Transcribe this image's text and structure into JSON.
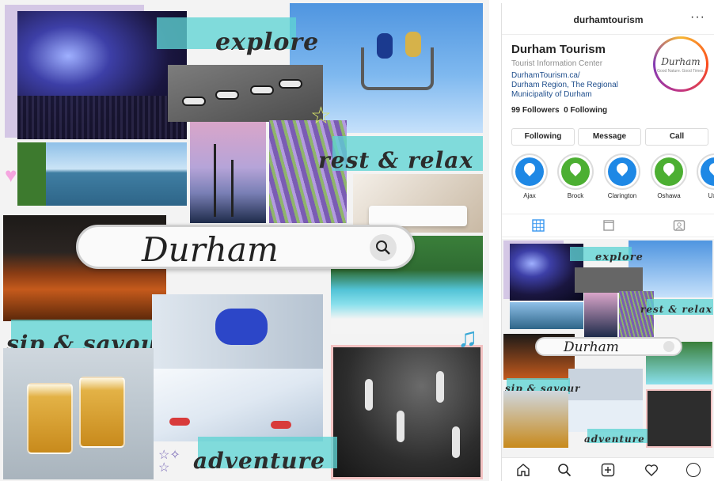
{
  "collage": {
    "labels": {
      "explore": "explore",
      "rest_relax": "rest & relax",
      "durham": "Durham",
      "sip_savour": "sip & savour",
      "adventure": "adventure"
    },
    "accent_colors": {
      "teal_wash": "#5fd3d3",
      "purple_wash": "#b9a2d8",
      "pink_wash": "#f3c0c9"
    },
    "icons": [
      "search-icon",
      "star-icon",
      "heart-icon",
      "music-note-icon",
      "stars-icon"
    ]
  },
  "instagram": {
    "topbar": {
      "username": "durhamtourism",
      "more": "···"
    },
    "profile": {
      "name": "Durham Tourism",
      "category": "Tourist Information Center",
      "link_lines": [
        "DurhamTourism.ca/",
        "Durham Region, The Regional",
        "Municipality of Durham"
      ],
      "followers_count": "99",
      "followers_label": "Followers",
      "following_count": "0",
      "following_label": "Following",
      "avatar_logo": "Durham",
      "avatar_sub": "Good Nature. Good Times."
    },
    "buttons": {
      "following": "Following",
      "message": "Message",
      "call": "Call"
    },
    "highlights": [
      {
        "label": "Ajax",
        "color": "#1e88e5"
      },
      {
        "label": "Brock",
        "color": "#4caf32"
      },
      {
        "label": "Clarington",
        "color": "#1e88e5"
      },
      {
        "label": "Oshawa",
        "color": "#4caf32"
      },
      {
        "label": "Uxbr",
        "color": "#1e88e5"
      }
    ],
    "tabs": [
      "grid-icon",
      "feed-icon",
      "tagged-icon"
    ],
    "bottom_nav": [
      "home-icon",
      "search-icon",
      "add-post-icon",
      "heart-icon",
      "profile-avatar-icon"
    ]
  }
}
